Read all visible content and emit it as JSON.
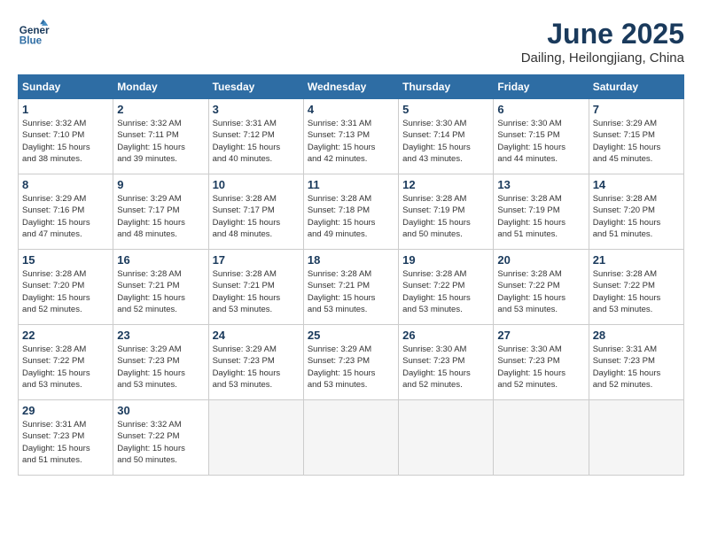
{
  "header": {
    "logo_line1": "General",
    "logo_line2": "Blue",
    "month": "June 2025",
    "location": "Dailing, Heilongjiang, China"
  },
  "weekdays": [
    "Sunday",
    "Monday",
    "Tuesday",
    "Wednesday",
    "Thursday",
    "Friday",
    "Saturday"
  ],
  "weeks": [
    [
      {
        "day": "1",
        "info": "Sunrise: 3:32 AM\nSunset: 7:10 PM\nDaylight: 15 hours\nand 38 minutes."
      },
      {
        "day": "2",
        "info": "Sunrise: 3:32 AM\nSunset: 7:11 PM\nDaylight: 15 hours\nand 39 minutes."
      },
      {
        "day": "3",
        "info": "Sunrise: 3:31 AM\nSunset: 7:12 PM\nDaylight: 15 hours\nand 40 minutes."
      },
      {
        "day": "4",
        "info": "Sunrise: 3:31 AM\nSunset: 7:13 PM\nDaylight: 15 hours\nand 42 minutes."
      },
      {
        "day": "5",
        "info": "Sunrise: 3:30 AM\nSunset: 7:14 PM\nDaylight: 15 hours\nand 43 minutes."
      },
      {
        "day": "6",
        "info": "Sunrise: 3:30 AM\nSunset: 7:15 PM\nDaylight: 15 hours\nand 44 minutes."
      },
      {
        "day": "7",
        "info": "Sunrise: 3:29 AM\nSunset: 7:15 PM\nDaylight: 15 hours\nand 45 minutes."
      }
    ],
    [
      {
        "day": "8",
        "info": "Sunrise: 3:29 AM\nSunset: 7:16 PM\nDaylight: 15 hours\nand 47 minutes."
      },
      {
        "day": "9",
        "info": "Sunrise: 3:29 AM\nSunset: 7:17 PM\nDaylight: 15 hours\nand 48 minutes."
      },
      {
        "day": "10",
        "info": "Sunrise: 3:28 AM\nSunset: 7:17 PM\nDaylight: 15 hours\nand 48 minutes."
      },
      {
        "day": "11",
        "info": "Sunrise: 3:28 AM\nSunset: 7:18 PM\nDaylight: 15 hours\nand 49 minutes."
      },
      {
        "day": "12",
        "info": "Sunrise: 3:28 AM\nSunset: 7:19 PM\nDaylight: 15 hours\nand 50 minutes."
      },
      {
        "day": "13",
        "info": "Sunrise: 3:28 AM\nSunset: 7:19 PM\nDaylight: 15 hours\nand 51 minutes."
      },
      {
        "day": "14",
        "info": "Sunrise: 3:28 AM\nSunset: 7:20 PM\nDaylight: 15 hours\nand 51 minutes."
      }
    ],
    [
      {
        "day": "15",
        "info": "Sunrise: 3:28 AM\nSunset: 7:20 PM\nDaylight: 15 hours\nand 52 minutes."
      },
      {
        "day": "16",
        "info": "Sunrise: 3:28 AM\nSunset: 7:21 PM\nDaylight: 15 hours\nand 52 minutes."
      },
      {
        "day": "17",
        "info": "Sunrise: 3:28 AM\nSunset: 7:21 PM\nDaylight: 15 hours\nand 53 minutes."
      },
      {
        "day": "18",
        "info": "Sunrise: 3:28 AM\nSunset: 7:21 PM\nDaylight: 15 hours\nand 53 minutes."
      },
      {
        "day": "19",
        "info": "Sunrise: 3:28 AM\nSunset: 7:22 PM\nDaylight: 15 hours\nand 53 minutes."
      },
      {
        "day": "20",
        "info": "Sunrise: 3:28 AM\nSunset: 7:22 PM\nDaylight: 15 hours\nand 53 minutes."
      },
      {
        "day": "21",
        "info": "Sunrise: 3:28 AM\nSunset: 7:22 PM\nDaylight: 15 hours\nand 53 minutes."
      }
    ],
    [
      {
        "day": "22",
        "info": "Sunrise: 3:28 AM\nSunset: 7:22 PM\nDaylight: 15 hours\nand 53 minutes."
      },
      {
        "day": "23",
        "info": "Sunrise: 3:29 AM\nSunset: 7:23 PM\nDaylight: 15 hours\nand 53 minutes."
      },
      {
        "day": "24",
        "info": "Sunrise: 3:29 AM\nSunset: 7:23 PM\nDaylight: 15 hours\nand 53 minutes."
      },
      {
        "day": "25",
        "info": "Sunrise: 3:29 AM\nSunset: 7:23 PM\nDaylight: 15 hours\nand 53 minutes."
      },
      {
        "day": "26",
        "info": "Sunrise: 3:30 AM\nSunset: 7:23 PM\nDaylight: 15 hours\nand 52 minutes."
      },
      {
        "day": "27",
        "info": "Sunrise: 3:30 AM\nSunset: 7:23 PM\nDaylight: 15 hours\nand 52 minutes."
      },
      {
        "day": "28",
        "info": "Sunrise: 3:31 AM\nSunset: 7:23 PM\nDaylight: 15 hours\nand 52 minutes."
      }
    ],
    [
      {
        "day": "29",
        "info": "Sunrise: 3:31 AM\nSunset: 7:23 PM\nDaylight: 15 hours\nand 51 minutes."
      },
      {
        "day": "30",
        "info": "Sunrise: 3:32 AM\nSunset: 7:22 PM\nDaylight: 15 hours\nand 50 minutes."
      },
      null,
      null,
      null,
      null,
      null
    ]
  ]
}
